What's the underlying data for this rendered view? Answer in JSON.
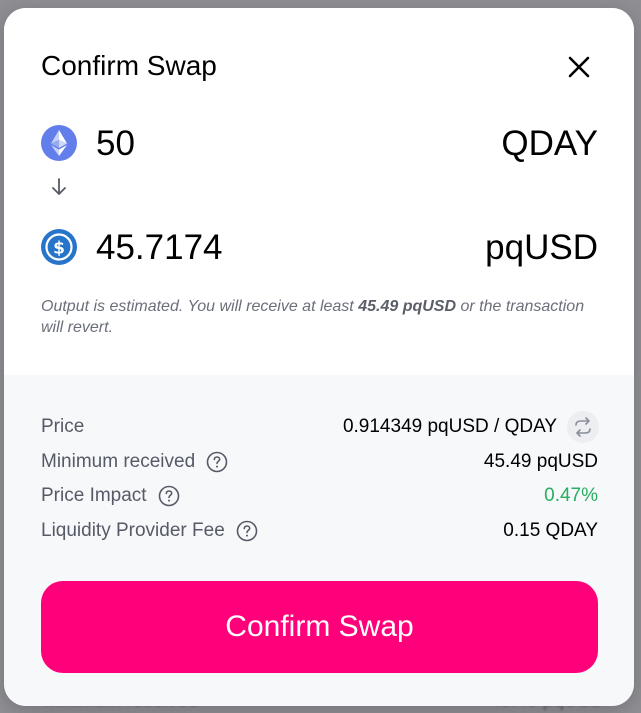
{
  "modal": {
    "title": "Confirm Swap"
  },
  "input_token": {
    "amount": "50",
    "symbol": "QDAY",
    "icon": "ethereum-icon"
  },
  "output_token": {
    "amount": "45.7174",
    "symbol": "pqUSD",
    "icon": "usdc-icon"
  },
  "note": {
    "prefix": "Output is estimated. You will receive at least ",
    "min_amount": "45.49 pqUSD",
    "suffix": " or the transaction will revert."
  },
  "details": {
    "price_label": "Price",
    "price_value": "0.914349 pqUSD / QDAY",
    "min_received_label": "Minimum received",
    "min_received_value": "45.49 pqUSD",
    "price_impact_label": "Price Impact",
    "price_impact_value": "0.47%",
    "lp_fee_label": "Liquidity Provider Fee",
    "lp_fee_value": "0.15 QDAY"
  },
  "confirm_button": {
    "label": "Confirm Swap"
  },
  "colors": {
    "accent": "#ff007a",
    "positive": "#27ae60",
    "ethereum": "#627eea",
    "usdc": "#2775ca"
  }
}
